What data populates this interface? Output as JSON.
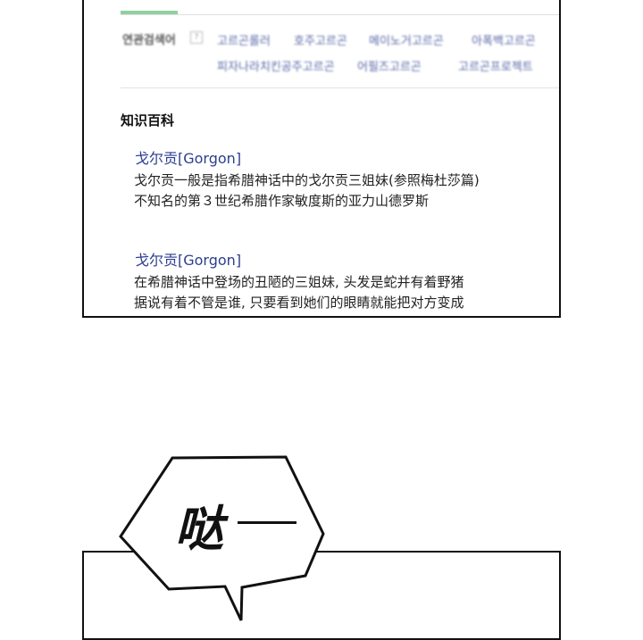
{
  "related_bar": {
    "label": "연관검색어",
    "help_icon": "?",
    "links_row1": [
      "고르곤롤러",
      "호주고르곤",
      "메이노거고르곤",
      "아폭백고르곤"
    ],
    "links_row2": [
      "피자나라치킨공주고르곤",
      "어필즈고르곤",
      "고르곤프로젝트"
    ]
  },
  "section_title": "知识百科",
  "entries": [
    {
      "title": "戈尔贡[Gorgon]",
      "lines": [
        "戈尔贡一般是指希腊神话中的戈尔贡三姐妹(参照梅杜莎篇)",
        "不知名的第３世纪希腊作家敏度斯的亚力山德罗斯"
      ]
    },
    {
      "title": "戈尔贡[Gorgon]",
      "lines": [
        "在希腊神话中登场的丑陋的三姐妹, 头发是蛇并有着野猪",
        "据说有着不管是谁, 只要看到她们的眼睛就能把对方变成"
      ]
    }
  ],
  "speech_bubble": {
    "sfx": "哒"
  }
}
